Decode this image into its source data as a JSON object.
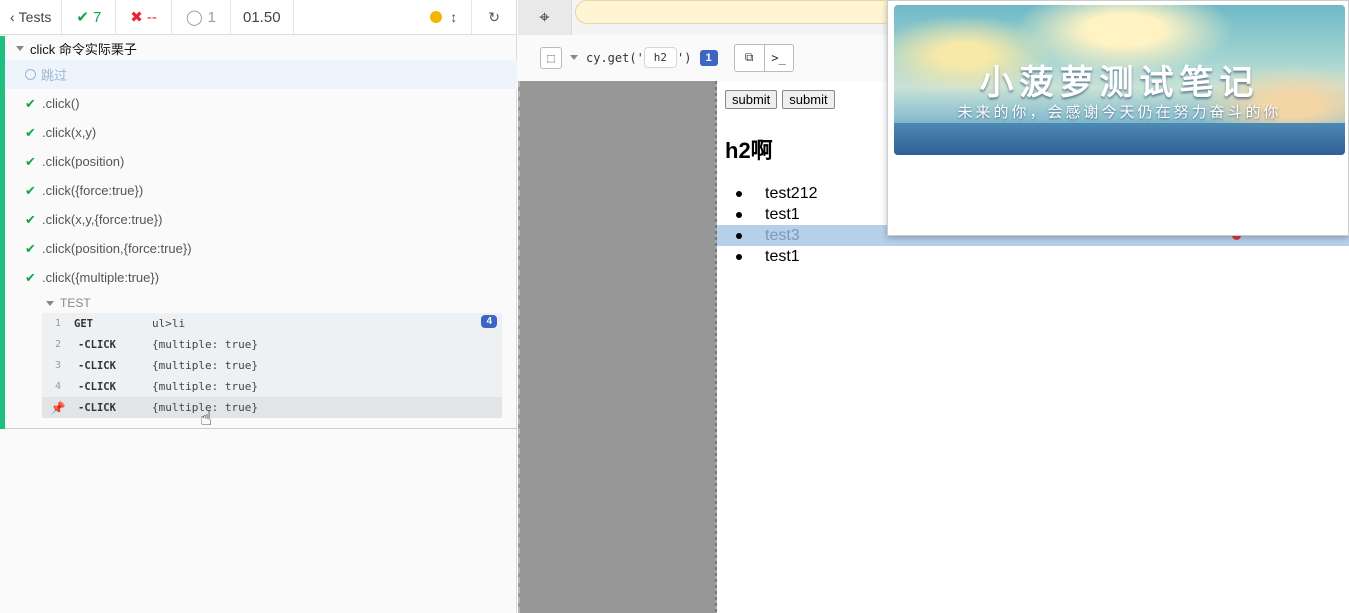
{
  "header": {
    "back_label": "Tests",
    "passed": "7",
    "failed": "--",
    "pending": "1",
    "duration": "01.50"
  },
  "suite": {
    "title": "click 命令实际栗子",
    "tests": [
      {
        "label": "跳过",
        "state": "pending"
      },
      {
        "label": ".click()",
        "state": "passed"
      },
      {
        "label": ".click(x,y)",
        "state": "passed"
      },
      {
        "label": ".click(position)",
        "state": "passed"
      },
      {
        "label": ".click({force:true})",
        "state": "passed"
      },
      {
        "label": ".click(x,y,{force:true})",
        "state": "passed"
      },
      {
        "label": ".click(position,{force:true})",
        "state": "passed"
      },
      {
        "label": ".click({multiple:true})",
        "state": "passed"
      }
    ],
    "command_group": "TEST",
    "commands": [
      {
        "num": "1",
        "name": "GET",
        "message": "ul>li",
        "badge": "4"
      },
      {
        "num": "2",
        "name": "-CLICK",
        "message": "{multiple: true}"
      },
      {
        "num": "3",
        "name": "-CLICK",
        "message": "{multiple: true}"
      },
      {
        "num": "4",
        "name": "-CLICK",
        "message": "{multiple: true}"
      },
      {
        "num": "",
        "name": "-CLICK",
        "message": "{multiple: true}"
      }
    ]
  },
  "selector_playground": {
    "prefix": "cy.get('",
    "value": "h2",
    "suffix": "')",
    "count": "1"
  },
  "aut": {
    "buttons": [
      "submit",
      "submit"
    ],
    "heading": "h2啊",
    "list": [
      "test212",
      "test1",
      "test3",
      "test1"
    ]
  },
  "banner": {
    "title": "小菠萝测试笔记",
    "subtitle": "未来的你，会感谢今天仍在努力奋斗的你"
  },
  "colors": {
    "passed": "#16a34a",
    "failed": "#e22233",
    "accent": "#3b66c4",
    "highlight": "#b7d0ea",
    "url_bar": "#fff4d4"
  }
}
